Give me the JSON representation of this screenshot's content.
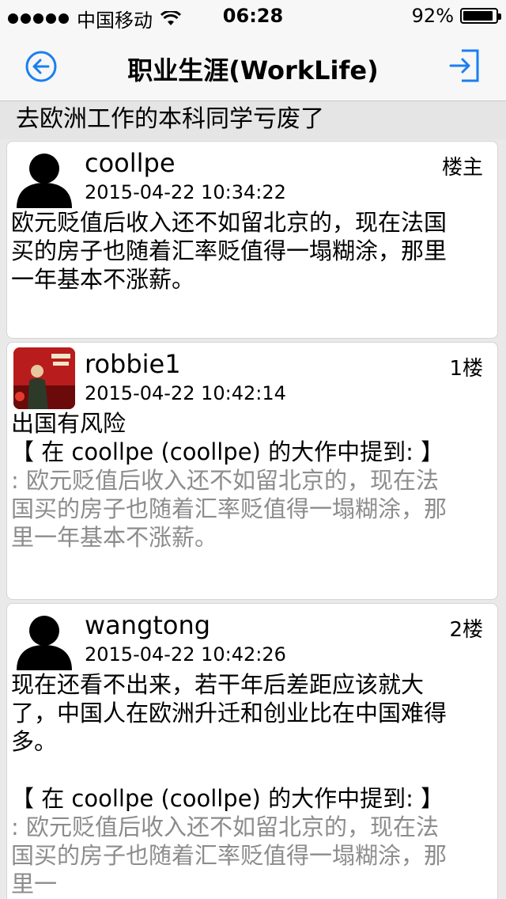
{
  "status_bar": {
    "carrier": "中国移动",
    "time": "06:28",
    "battery_text": "92%",
    "battery_level_percent": 92,
    "icons": [
      "signal-dots-icon",
      "wifi-icon",
      "battery-icon"
    ]
  },
  "nav": {
    "title": "职业生涯(WorkLife)",
    "accent_color": "#1a7ff0",
    "back_icon": "back-arrow-circle-icon",
    "exit_icon": "sign-in-icon"
  },
  "thread": {
    "subject": "去欧洲工作的本科同学亏废了"
  },
  "posts": [
    {
      "author": "coollpe",
      "floor": "楼主",
      "time": "2015-04-22 10:34:22",
      "avatar": "default-avatar-icon",
      "content": [
        "欧元贬值后收入还不如留北京的，现在法国",
        "买的房子也随着汇率贬值得一塌糊涂，那里",
        "一年基本不涨薪。"
      ]
    },
    {
      "author": "robbie1",
      "floor": "1楼",
      "time": "2015-04-22 10:42:14",
      "avatar": "photo-avatar-icon",
      "content": [
        "出国有风险"
      ],
      "quote_header": "【 在 coollpe (coollpe) 的大作中提到: 】",
      "quote": [
        ": 欧元贬值后收入还不如留北京的，现在法",
        "国买的房子也随着汇率贬值得一塌糊涂，那",
        "里一年基本不涨薪。"
      ]
    },
    {
      "author": "wangtong",
      "floor": "2楼",
      "time": "2015-04-22 10:42:26",
      "avatar": "default-avatar-icon",
      "content": [
        "现在还看不出来，若干年后差距应该就大",
        "了，中国人在欧洲升迁和创业比在中国难得",
        "多。"
      ],
      "quote_header": "【 在 coollpe (coollpe) 的大作中提到: 】",
      "quote": [
        ": 欧元贬值后收入还不如留北京的，现在法",
        "国买的房子也随着汇率贬值得一塌糊涂，那",
        "里一"
      ]
    }
  ]
}
